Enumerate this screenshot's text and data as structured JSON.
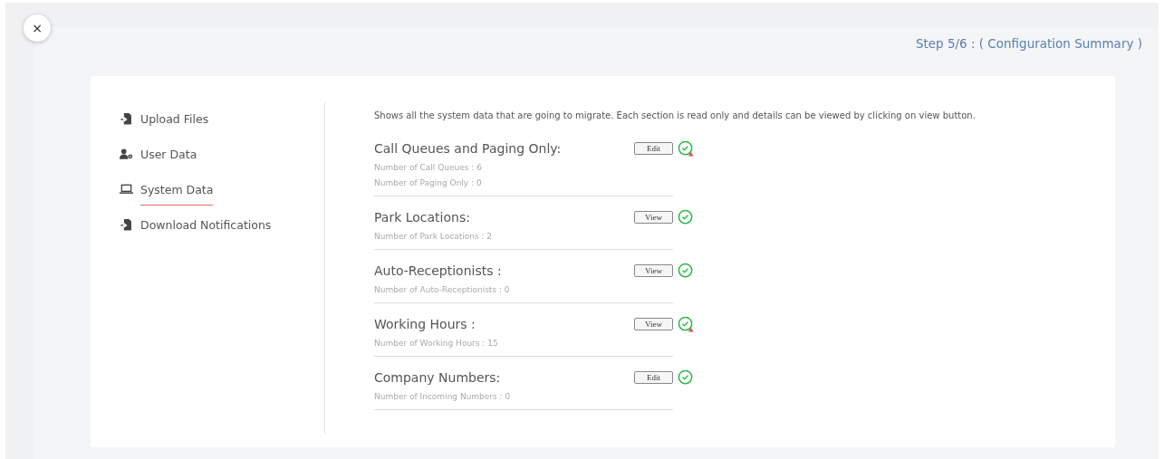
{
  "close_button": "×",
  "step_title": "Step 5/6 : ( Configuration Summary )",
  "sidebar": {
    "items": [
      {
        "label": "Upload Files",
        "kind": "upload",
        "selected": false
      },
      {
        "label": "User Data",
        "kind": "users",
        "selected": false
      },
      {
        "label": "System Data",
        "kind": "system",
        "selected": true
      },
      {
        "label": "Download Notifications",
        "kind": "upload",
        "selected": false
      }
    ]
  },
  "description": "Shows all the system data that are going to migrate. Each section is read only and details can be viewed by clicking on view button.",
  "sections": [
    {
      "title": "Call Queues and Paging Only:",
      "details": [
        "Number of Call Queues : 6",
        "Number of Paging Only : 0"
      ],
      "button": "Edit",
      "complete": true,
      "warning": true
    },
    {
      "title": "Park Locations:",
      "details": [
        "Number of Park Locations : 2"
      ],
      "button": "View",
      "complete": true,
      "warning": false
    },
    {
      "title": "Auto-Receptionists :",
      "details": [
        "Number of Auto-Receptionists : 0"
      ],
      "button": "View",
      "complete": true,
      "warning": false
    },
    {
      "title": "Working Hours :",
      "details": [
        "Number of Working Hours : 15"
      ],
      "button": "View",
      "complete": true,
      "warning": true
    },
    {
      "title": "Company Numbers:",
      "details": [
        "Number of Incoming Numbers : 0"
      ],
      "button": "Edit",
      "complete": true,
      "warning": false
    }
  ]
}
